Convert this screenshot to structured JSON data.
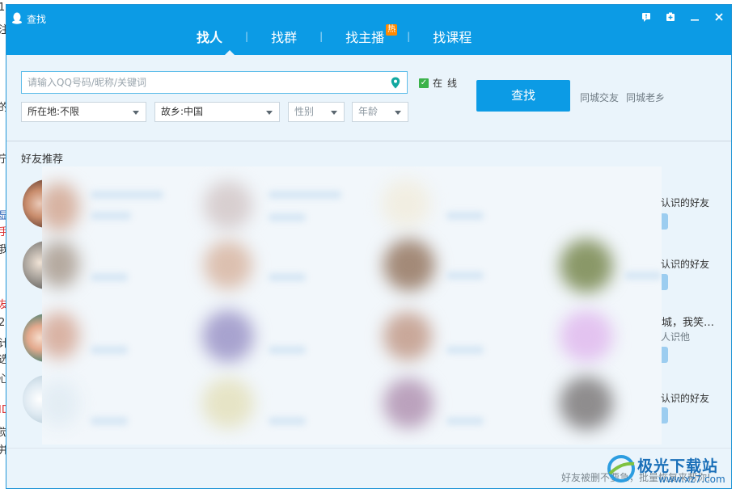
{
  "background_fragments": [
    "1",
    "注",
    "的",
    "宁",
    "显",
    "手",
    "我",
    "友",
    "2",
    "计",
    "选",
    "心",
    "ID",
    "觉",
    "并"
  ],
  "window": {
    "title": "查找",
    "controls": [
      "feedback-icon",
      "skin-icon",
      "minimize-icon",
      "close-icon"
    ]
  },
  "tabs": [
    {
      "label": "找人",
      "active": true
    },
    {
      "label": "找群",
      "active": false
    },
    {
      "label": "找主播",
      "active": false,
      "badge": "热"
    },
    {
      "label": "找课程",
      "active": false
    }
  ],
  "search": {
    "placeholder": "请输入QQ号码/昵称/关键词",
    "value": "",
    "online_label": "在线",
    "online_checked": true,
    "button_label": "查找",
    "quick_links": [
      "同城交友",
      "同城老乡"
    ]
  },
  "filters": [
    {
      "label": "所在地:不限",
      "is_placeholder": false
    },
    {
      "label": "故乡:中国",
      "is_placeholder": false
    },
    {
      "label": "性别",
      "is_placeholder": true
    },
    {
      "label": "年龄",
      "is_placeholder": true
    }
  ],
  "recommend": {
    "title": "好友推荐",
    "side_texts": [
      "可能认识的好友",
      "可能认识的好友",
      "城，我笑…",
      "人识他",
      "可能认识的好友"
    ]
  },
  "footer": {
    "link": "好友被删不要急，批量恢复来帮你!"
  },
  "watermark": {
    "title": "极光下载站",
    "subtitle": "www.xz7.com"
  },
  "colors": {
    "accent": "#0c9be5",
    "hot_badge": "#ff8a00",
    "checkbox": "#3bb24a"
  }
}
